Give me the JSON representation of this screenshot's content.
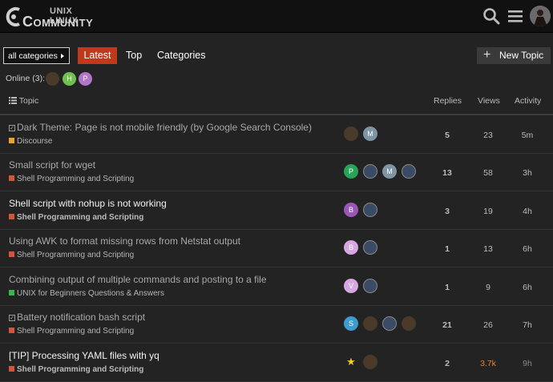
{
  "header": {
    "logo_top": "UNIX LINUX",
    "logo_bottom": "Community"
  },
  "nav": {
    "category_select": "all categories",
    "tabs": [
      "Latest",
      "Top",
      "Categories"
    ],
    "new_topic": "New Topic"
  },
  "online": {
    "label": "Online (3):",
    "avatars": [
      {
        "initial": "",
        "color": "#4a3a2a"
      },
      {
        "initial": "H",
        "color": "#6cc24a"
      },
      {
        "initial": "P",
        "color": "#b276c9"
      }
    ]
  },
  "table": {
    "headers": {
      "topic": "Topic",
      "replies": "Replies",
      "views": "Views",
      "activity": "Activity"
    },
    "rows": [
      {
        "title": "Dark Theme: Page is not mobile friendly (by Google Search Console)",
        "pinned": true,
        "bold": false,
        "category": "Discourse",
        "category_color": "#e9a131",
        "replies": "5",
        "views": "23",
        "activity": "5m",
        "avatars": [
          {
            "initial": "",
            "type": "dark"
          },
          {
            "initial": "M",
            "color": "#7d95a4"
          }
        ]
      },
      {
        "title": "Small script for wget",
        "pinned": false,
        "bold": false,
        "category": "Shell Programming and Scripting",
        "category_color": "#d9533a",
        "replies": "13",
        "views": "58",
        "activity": "3h",
        "avatars": [
          {
            "initial": "P",
            "color": "#29a35a"
          },
          {
            "initial": "",
            "type": "img"
          },
          {
            "initial": "M",
            "color": "#7d95a4"
          },
          {
            "initial": "",
            "type": "img"
          }
        ]
      },
      {
        "title": "Shell script with nohup is not working",
        "pinned": false,
        "bold": true,
        "category": "Shell Programming and Scripting",
        "category_color": "#d9533a",
        "replies": "3",
        "views": "19",
        "activity": "4h",
        "avatars": [
          {
            "initial": "B",
            "color": "#9b57b8"
          },
          {
            "initial": "",
            "type": "img"
          }
        ]
      },
      {
        "title": "Using AWK to format missing rows from Netstat output",
        "pinned": false,
        "bold": false,
        "category": "Shell Programming and Scripting",
        "category_color": "#d9533a",
        "replies": "1",
        "views": "13",
        "activity": "6h",
        "avatars": [
          {
            "initial": "B",
            "color": "#d6a7e0"
          },
          {
            "initial": "",
            "type": "img"
          }
        ]
      },
      {
        "title": "Combining output of multiple commands and posting to a file",
        "pinned": false,
        "bold": false,
        "category": "UNIX for Beginners Questions & Answers",
        "category_color": "#3ab54a",
        "replies": "1",
        "views": "9",
        "activity": "6h",
        "avatars": [
          {
            "initial": "V",
            "color": "#d6a7e0"
          },
          {
            "initial": "",
            "type": "img"
          }
        ]
      },
      {
        "title": "Battery notification bash script",
        "pinned": true,
        "bold": false,
        "category": "Shell Programming and Scripting",
        "category_color": "#d9533a",
        "replies": "21",
        "views": "26",
        "activity": "7h",
        "avatars": [
          {
            "initial": "S",
            "color": "#3c9bcf"
          },
          {
            "initial": "",
            "type": "dark"
          },
          {
            "initial": "",
            "type": "img"
          },
          {
            "initial": "",
            "type": "dark"
          }
        ]
      },
      {
        "title": "[TIP] Processing YAML files with yq",
        "pinned": false,
        "bold": true,
        "category": "Shell Programming and Scripting",
        "category_color": "#d9533a",
        "replies": "2",
        "views": "3.7k",
        "activity": "9h",
        "hot_views": true,
        "dim_activity": true,
        "avatars": [
          {
            "initial": "★",
            "color": "transparent"
          },
          {
            "initial": "",
            "type": "dark"
          }
        ]
      }
    ]
  }
}
